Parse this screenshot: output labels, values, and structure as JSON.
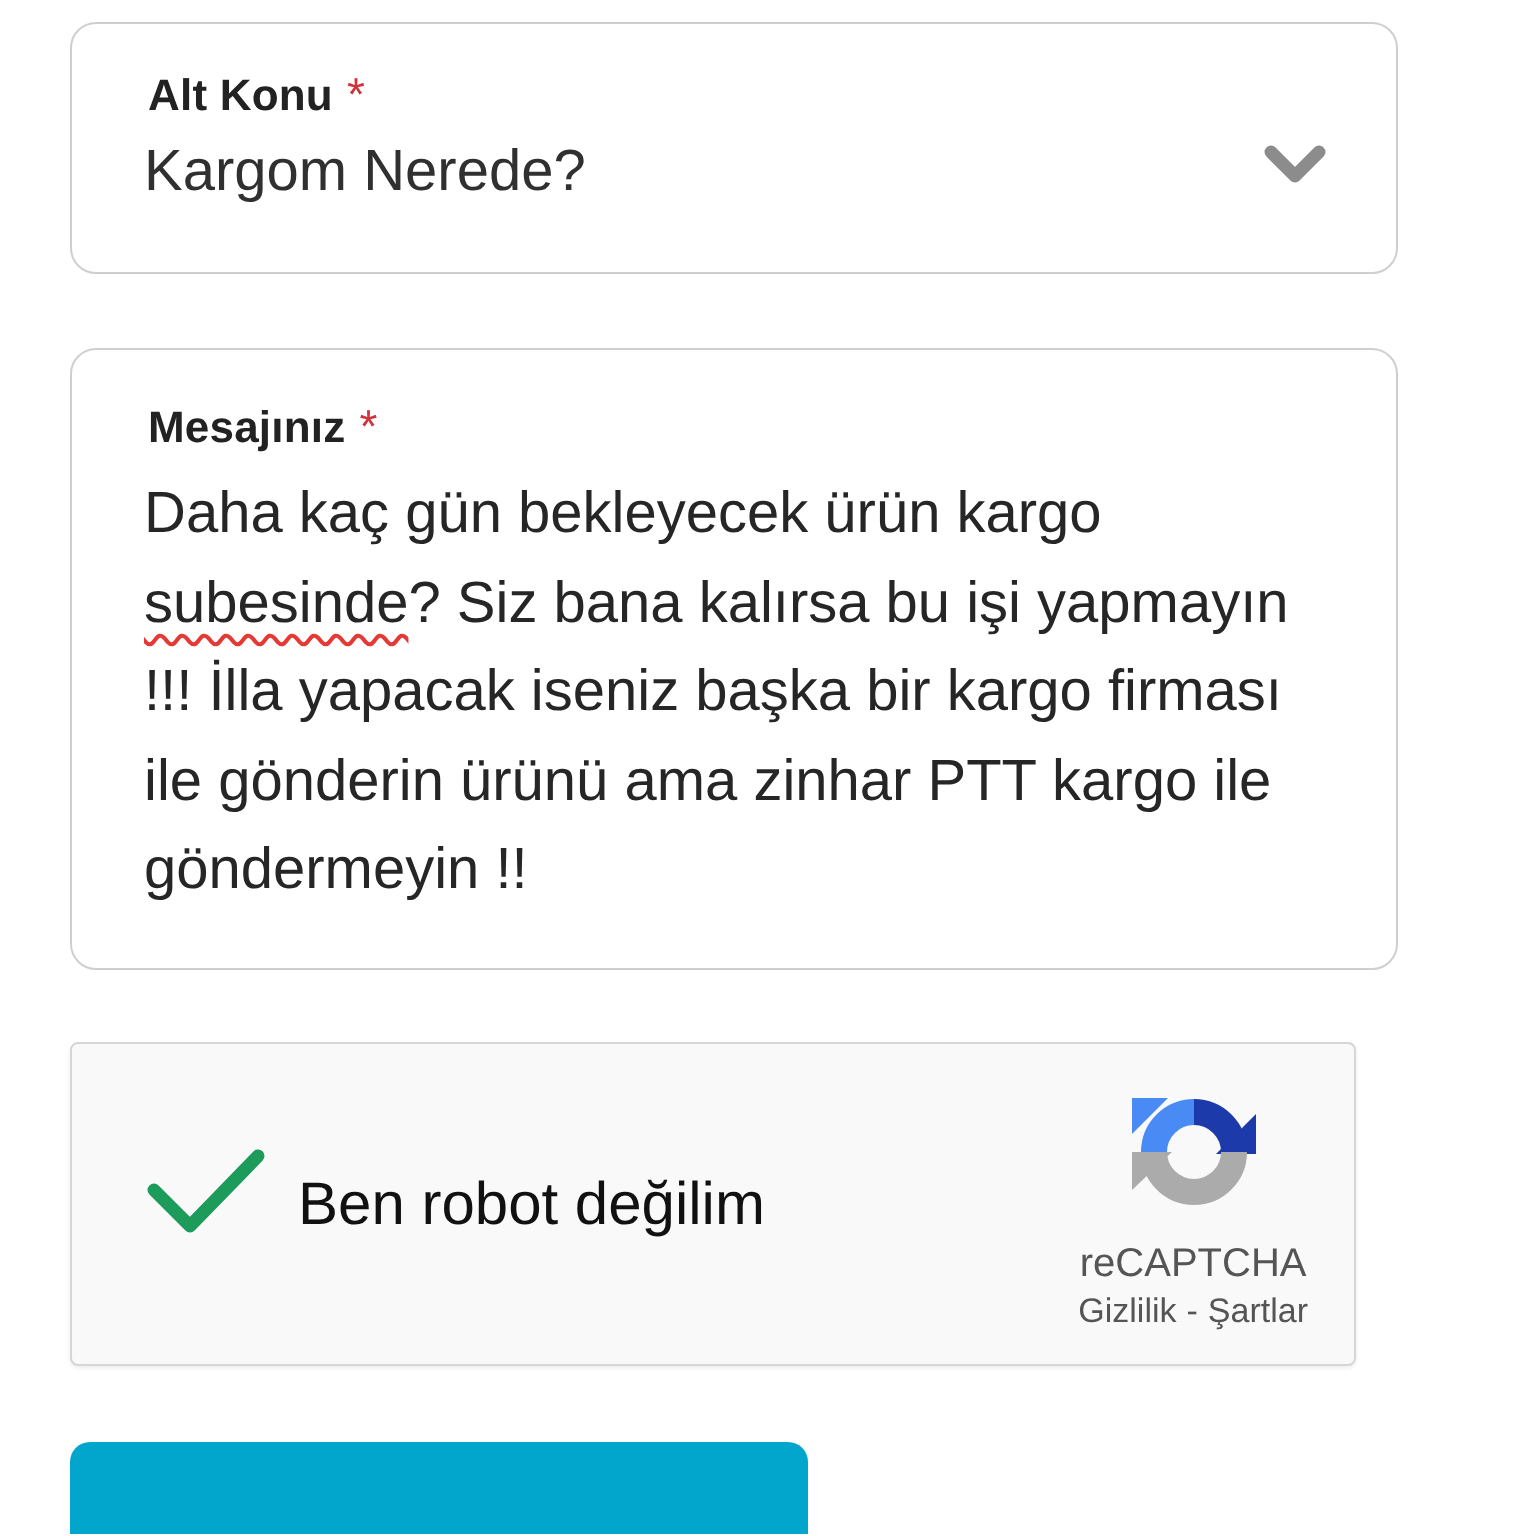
{
  "fields": [
    {
      "kind": "select",
      "label": "Alt Konu",
      "required_mark": "*",
      "value": "Kargom Nerede?"
    },
    {
      "kind": "textarea",
      "label": "Mesajınız",
      "required_mark": "*",
      "value_parts": [
        {
          "text": "Daha kaç gün bekleyecek ürün kargo ",
          "misspelled": false
        },
        {
          "text": "subesinde",
          "misspelled": true
        },
        {
          "text": "? Siz bana kalırsa bu işi yapmayın !!! İlla yapacak iseniz başka bir kargo firması ile gönderin ürünü ama zinhar PTT kargo ile göndermeyin !!",
          "misspelled": false
        }
      ]
    }
  ],
  "captcha": {
    "checked": true,
    "label": "Ben robot değilim",
    "brand": "reCAPTCHA",
    "privacy_link": "Gizlilik",
    "separator": "-",
    "terms_link": "Şartlar"
  }
}
